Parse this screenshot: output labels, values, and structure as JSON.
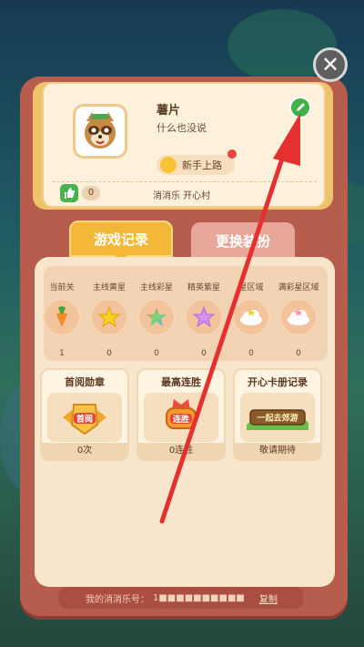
{
  "close_label": "✕",
  "profile": {
    "nickname": "薯片",
    "signature": "什么也没说",
    "title_badge": "新手上路",
    "likes": "0",
    "village": "消消乐  开心村"
  },
  "tabs": [
    {
      "label": "游戏记录",
      "active": true
    },
    {
      "label": "更换装扮",
      "active": false
    }
  ],
  "stats": [
    {
      "label": "当前关",
      "value": "1",
      "icon": "carrot-icon"
    },
    {
      "label": "主线黄星",
      "value": "0",
      "icon": "yellow-star-icon"
    },
    {
      "label": "主线彩星",
      "value": "0",
      "icon": "rainbow-star-icon"
    },
    {
      "label": "精英紫星",
      "value": "0",
      "icon": "purple-star-icon"
    },
    {
      "label": "星区域",
      "value": "0",
      "icon": "cloud-icon"
    },
    {
      "label": "满彩星区域",
      "value": "0",
      "icon": "rainbow-cloud-icon"
    }
  ],
  "achievements": [
    {
      "title": "首阅勋章",
      "badge": "首阅",
      "footer": "0次"
    },
    {
      "title": "最高连胜",
      "badge": "连胜",
      "footer": "0连胜"
    },
    {
      "title": "开心卡册记录",
      "badge": "一起去郊游",
      "footer": "敬请期待"
    }
  ],
  "footer": {
    "label": "我的消消乐号：",
    "number": "1■■■■■■■■■■",
    "copy_label": "复制"
  },
  "colors": {
    "tab_active": "#f4b838",
    "tab_inactive": "#e7a79a",
    "wallet": "#b75d4e",
    "arrow": "#e53030"
  }
}
